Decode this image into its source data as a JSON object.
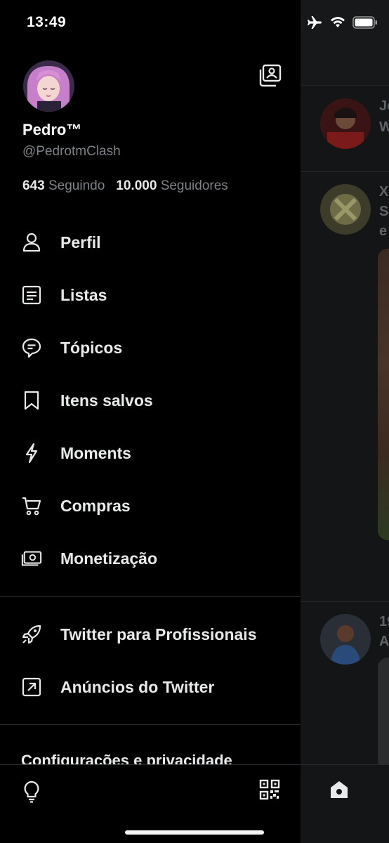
{
  "status_bar": {
    "time": "13:49"
  },
  "profile": {
    "name": "Pedro™",
    "handle": "@PedrotmClash",
    "following_count": "643",
    "following_label": "Seguindo",
    "followers_count": "10.000",
    "followers_label": "Seguidores"
  },
  "menu": [
    {
      "label": "Perfil",
      "icon": "person-icon"
    },
    {
      "label": "Listas",
      "icon": "list-icon"
    },
    {
      "label": "Tópicos",
      "icon": "topics-icon"
    },
    {
      "label": "Itens salvos",
      "icon": "bookmark-icon"
    },
    {
      "label": "Moments",
      "icon": "lightning-icon"
    },
    {
      "label": "Compras",
      "icon": "cart-icon"
    },
    {
      "label": "Monetização",
      "icon": "money-icon"
    }
  ],
  "secondary_menu": [
    {
      "label": "Twitter para Profissionais",
      "icon": "rocket-icon"
    },
    {
      "label": "Anúncios do Twitter",
      "icon": "external-arrow-icon"
    }
  ],
  "settings_label": "Configurações e privacidade",
  "timeline_peek": {
    "tweet1_text": [
      "Jo",
      "W"
    ],
    "tweet2_text": [
      "X",
      "S",
      "e"
    ],
    "tweet3_text": [
      "19",
      "A"
    ]
  },
  "colors": {
    "background": "#000000",
    "text_primary": "#e7e9ea",
    "text_secondary": "#7d8287",
    "divider": "#2a2d30"
  }
}
